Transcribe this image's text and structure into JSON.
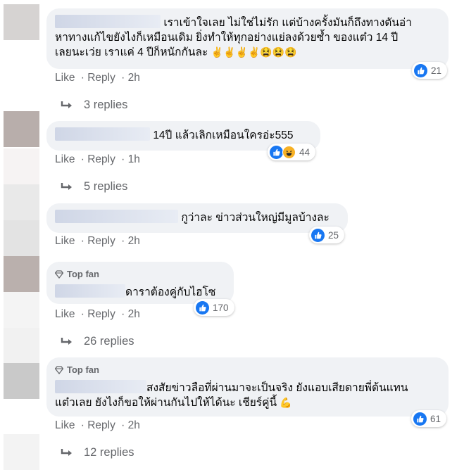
{
  "comments": [
    {
      "text_line1": "เราเข้าใจเลย ไม่ใช่ไม่รัก แต่บ้างครั้งมันก็ถึงทางตันอ่า",
      "text_line2": "หาทางแก้ไขยังไงก็เหมือนเดิม ยิ่งทำให้ทุกอย่างแย่ลงด้วยซ้ำ ของแต๋ว 14 ปี",
      "text_line3": "เลยนะเว่ย เราแค่ 4 ปีก็หนักกันละ",
      "emojis": "✌✌✌✌😫😫😫",
      "reaction_count": "21",
      "like_label": "Like",
      "reply_label": "Reply",
      "time": "2h",
      "replies_label": "3 replies"
    },
    {
      "text_line1": "14ปี แล้วเลิกเหมือนใครอ่ะ555",
      "reaction_count": "44",
      "like_label": "Like",
      "reply_label": "Reply",
      "time": "1h",
      "replies_label": "5 replies"
    },
    {
      "text_line1": "กูว่าละ ข่าวส่วนใหญ่มีมูลบ้างละ",
      "reaction_count": "25",
      "like_label": "Like",
      "reply_label": "Reply",
      "time": "2h"
    },
    {
      "badge": "Top fan",
      "text_line1": "ดาราต้องคู่กับไฮโซ",
      "reaction_count": "170",
      "like_label": "Like",
      "reply_label": "Reply",
      "time": "2h",
      "replies_label": "26 replies"
    },
    {
      "badge": "Top fan",
      "text_line1": "สงสัยข่าวลือที่ผ่านมาจะเป็นจริง ยังแอบเสียดายพี่ต้นแทน",
      "text_line2": "แต๋วเลย ยังไงก็ขอให้ผ่านกันไปให้ได้นะ เชียร์คู่นี้",
      "emoji": "💪",
      "reaction_count": "61",
      "like_label": "Like",
      "reply_label": "Reply",
      "time": "2h",
      "replies_label": "12 replies"
    }
  ],
  "colors": {
    "bubble": "#f0f2f5",
    "meta": "#65676b",
    "like": "#1877f2",
    "haha": "#f7b125"
  }
}
